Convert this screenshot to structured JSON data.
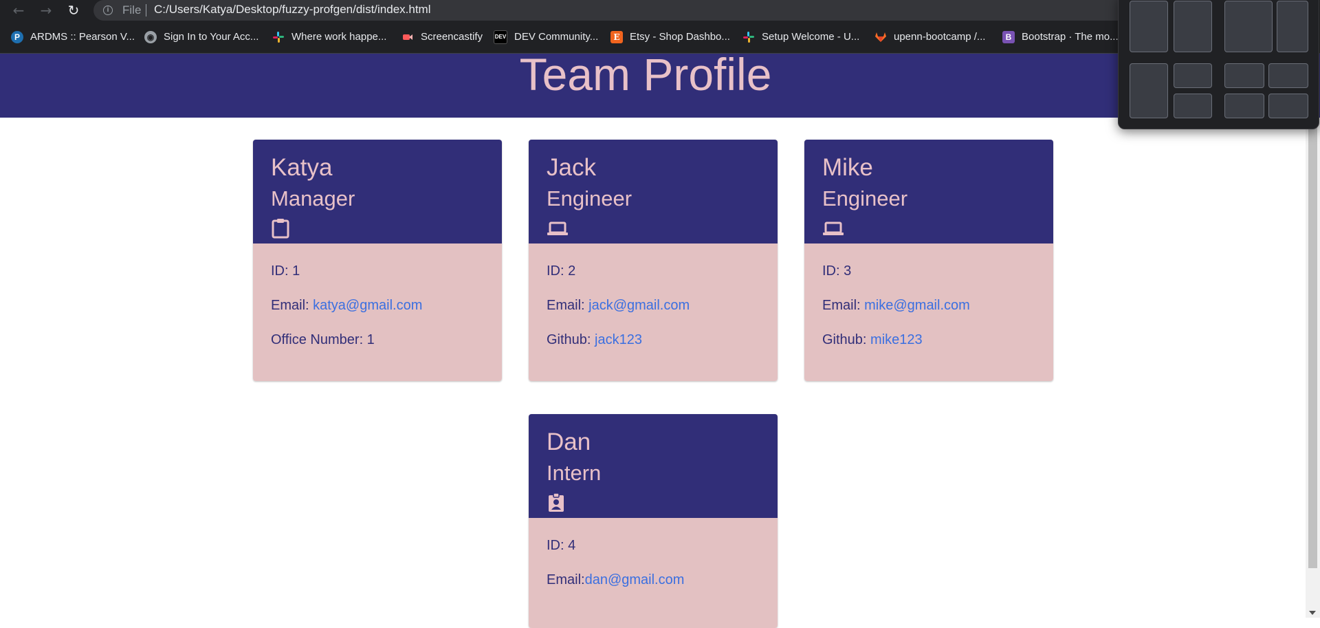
{
  "browser": {
    "scheme_label": "File",
    "url": "C:/Users/Katya/Desktop/fuzzy-profgen/dist/index.html",
    "bookmarks": [
      {
        "label": "ARDMS :: Pearson V...",
        "icon": "pearson-icon",
        "color": "#1e6fb0"
      },
      {
        "label": "Sign In to Your Acc...",
        "icon": "globe-icon",
        "color": "#9aa0a6"
      },
      {
        "label": "Where work happe...",
        "icon": "slack-icon",
        "color": "#e01e5a"
      },
      {
        "label": "Screencastify",
        "icon": "screencastify-icon",
        "color": "#ff5a5a"
      },
      {
        "label": "DEV Community...",
        "icon": "dev-icon",
        "color": "#000000"
      },
      {
        "label": "Etsy - Shop Dashbo...",
        "icon": "etsy-icon",
        "color": "#f1641e"
      },
      {
        "label": "Setup Welcome - U...",
        "icon": "slack-icon",
        "color": "#36c5f0"
      },
      {
        "label": "upenn-bootcamp /...",
        "icon": "gitlab-icon",
        "color": "#fc6d26"
      },
      {
        "label": "Bootstrap · The mo...",
        "icon": "bootstrap-icon",
        "color": "#7952b3"
      }
    ]
  },
  "page": {
    "title": "Team Profile"
  },
  "team": [
    {
      "name": "Katya",
      "role": "Manager",
      "icon": "clipboard-icon",
      "id_label": "ID: 1",
      "email_label": "Email: ",
      "email": "katya@gmail.com",
      "extra_label": "Office Number: 1",
      "extra_link": ""
    },
    {
      "name": "Jack",
      "role": "Engineer",
      "icon": "laptop-icon",
      "id_label": "ID: 2",
      "email_label": "Email: ",
      "email": "jack@gmail.com",
      "extra_label": "Github: ",
      "extra_link": "jack123"
    },
    {
      "name": "Mike",
      "role": "Engineer",
      "icon": "laptop-icon",
      "id_label": "ID: 3",
      "email_label": "Email: ",
      "email": "mike@gmail.com",
      "extra_label": "Github: ",
      "extra_link": "mike123"
    },
    {
      "name": "Dan",
      "role": "Intern",
      "icon": "id-badge-icon",
      "id_label": "ID: 4",
      "email_label": "Email:",
      "email": "dan@gmail.com",
      "extra_label": "",
      "extra_link": ""
    }
  ],
  "colors": {
    "header_bg": "#312e78",
    "header_text": "#e8c1c8",
    "card_body_bg": "#e3c1c2",
    "link": "#3b6fe0"
  }
}
